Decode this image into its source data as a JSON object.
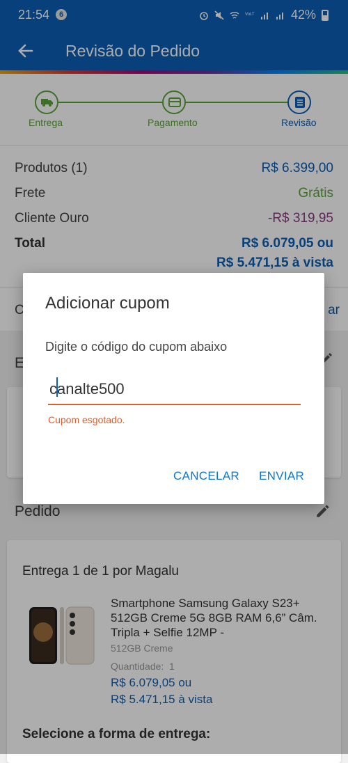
{
  "statusbar": {
    "time": "21:54",
    "notif_count": "6",
    "battery": "42%"
  },
  "appbar": {
    "title": "Revisão do Pedido"
  },
  "steps": [
    {
      "label": "Entrega",
      "icon": "truck-icon",
      "state": "done"
    },
    {
      "label": "Pagamento",
      "icon": "card-icon",
      "state": "done"
    },
    {
      "label": "Revisão",
      "icon": "list-icon",
      "state": "active"
    }
  ],
  "summary": {
    "produtos_label": "Produtos (1)",
    "produtos_value": "R$ 6.399,00",
    "frete_label": "Frete",
    "frete_value": "Grátis",
    "cliente_label": "Cliente Ouro",
    "cliente_value": "-R$ 319,95",
    "total_label": "Total",
    "total_value_1": "R$ 6.079,05 ou",
    "total_value_2": "R$ 5.471,15 à vista"
  },
  "cupom_row": {
    "label_partial": "C",
    "action_partial": "ar"
  },
  "endereco_section": {
    "title_partial": "E"
  },
  "pedido": {
    "title": "Pedido",
    "delivery": "Entrega 1 de 1 por Magalu",
    "product_name": "Smartphone Samsung Galaxy S23+ 512GB Creme 5G 8GB RAM 6,6” Câm. Tripla + Selfie 12MP -",
    "variant": "512GB Creme",
    "quantity": "Quantidade:  1",
    "price_1": "R$ 6.079,05 ou",
    "price_2": "R$ 5.471,15 à vista",
    "shipping_prompt": "Selecione a forma de entrega:"
  },
  "dialog": {
    "title": "Adicionar cupom",
    "instruction": "Digite o código do cupom abaixo",
    "code": "canalte500",
    "error": "Cupom esgotado.",
    "cancel": "CANCELAR",
    "send": "ENVIAR"
  },
  "colors": {
    "brand_blue": "#0b5fb5",
    "success_green": "#59a536",
    "discount_purple": "#8a3f80",
    "error_orange": "#e05d2d",
    "button_blue": "#0b78d0"
  }
}
